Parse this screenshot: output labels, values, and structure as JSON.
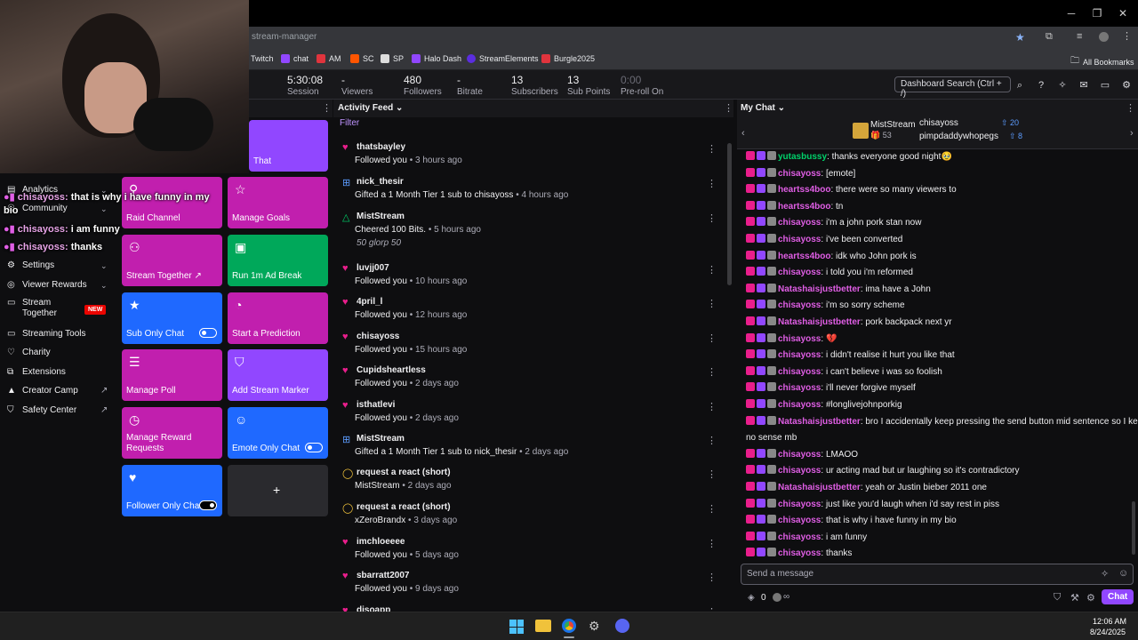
{
  "browser": {
    "url": "stream-manager",
    "bookmarks": [
      "Twitch",
      "chat",
      "AM",
      "SC",
      "SP",
      "Halo Dash",
      "StreamElements",
      "Burgle2025"
    ],
    "all_bookmarks": "All Bookmarks"
  },
  "stats": [
    {
      "value": "5:30:08",
      "label": "Session"
    },
    {
      "value": "-",
      "label": "Viewers"
    },
    {
      "value": "480",
      "label": "Followers"
    },
    {
      "value": "-",
      "label": "Bitrate"
    },
    {
      "value": "13",
      "label": "Subscribers"
    },
    {
      "value": "13",
      "label": "Sub Points"
    },
    {
      "value": "0:00",
      "label": "Pre-roll On"
    }
  ],
  "dashboard_search": "Dashboard Search (Ctrl + /)",
  "nav": [
    {
      "label": "Analytics"
    },
    {
      "label": "Community"
    },
    {
      "label": "Settings"
    },
    {
      "label": "Viewer Rewards"
    },
    {
      "label": "Stream Together",
      "badge": "NEW"
    },
    {
      "label": "Streaming Tools"
    },
    {
      "label": "Charity"
    },
    {
      "label": "Extensions"
    },
    {
      "label": "Creator Camp"
    },
    {
      "label": "Safety Center"
    }
  ],
  "overlay_chat": [
    {
      "user": "chisayoss:",
      "text": "that is why i have funny in my"
    },
    {
      "user": "",
      "text": "bio"
    },
    {
      "user": "chisayoss:",
      "text": "i am funny"
    },
    {
      "user": "chisayoss:",
      "text": "thanks"
    }
  ],
  "quick_actions": {
    "top_partial": "That",
    "tiles": [
      "Raid Channel",
      "Manage Goals",
      "Stream Together ↗",
      "Run 1m Ad Break",
      "Sub Only Chat",
      "Start a Prediction",
      "Manage Poll",
      "Add Stream Marker",
      "Manage Reward Requests",
      "Emote Only Chat",
      "Follower Only Chat",
      "+"
    ]
  },
  "activity": {
    "title": "Activity Feed",
    "filter": "Filter",
    "items": [
      {
        "name": "thatsbayley",
        "action": "Followed you",
        "time": "3 hours ago"
      },
      {
        "name": "nick_thesir",
        "action": "Gifted a 1 Month Tier 1 sub to chisayoss",
        "time": "4 hours ago"
      },
      {
        "name": "MistStream",
        "action": "Cheered 100 Bits.",
        "time": "5 hours ago",
        "extra": "50 glorp   50"
      },
      {
        "name": "luvjj007",
        "action": "Followed you",
        "time": "10 hours ago"
      },
      {
        "name": "4pril_l",
        "action": "Followed you",
        "time": "12 hours ago"
      },
      {
        "name": "chisayoss",
        "action": "Followed you",
        "time": "15 hours ago"
      },
      {
        "name": "Cupidsheartless",
        "action": "Followed you",
        "time": "2 days ago"
      },
      {
        "name": "isthatlevi",
        "action": "Followed you",
        "time": "2 days ago"
      },
      {
        "name": "MistStream",
        "action": "Gifted a 1 Month Tier 1 sub to nick_thesir",
        "time": "2 days ago"
      },
      {
        "name": "request a react (short)",
        "action": "MistStream",
        "time": "2 days ago"
      },
      {
        "name": "request a react (short)",
        "action": "xZeroBrandx",
        "time": "3 days ago"
      },
      {
        "name": "imchloeeee",
        "action": "Followed you",
        "time": "5 days ago"
      },
      {
        "name": "sbarratt2007",
        "action": "Followed you",
        "time": "9 days ago"
      },
      {
        "name": "disoapp",
        "action": "",
        "time": ""
      }
    ]
  },
  "chat": {
    "title": "My Chat",
    "leaderboard": [
      {
        "name": "MistStream",
        "count": "53"
      },
      {
        "name": "chisayoss",
        "count": "20"
      },
      {
        "name": "pimpdaddywhopegs",
        "count": "8"
      }
    ],
    "messages": [
      {
        "user": "yutasbussy",
        "color": "#00d26a",
        "text": "thanks everyone good night🥹"
      },
      {
        "user": "chisayoss",
        "color": "#e05ee5",
        "text": "[emote]"
      },
      {
        "user": "heartss4boo",
        "color": "#e05ee5",
        "text": "there were so many viewers to"
      },
      {
        "user": "heartss4boo",
        "color": "#e05ee5",
        "text": "tn"
      },
      {
        "user": "chisayoss",
        "color": "#e05ee5",
        "text": "i'm a john pork stan now"
      },
      {
        "user": "chisayoss",
        "color": "#e05ee5",
        "text": "i've been converted"
      },
      {
        "user": "heartss4boo",
        "color": "#e05ee5",
        "text": "idk who John pork is"
      },
      {
        "user": "chisayoss",
        "color": "#e05ee5",
        "text": "i told you i'm reformed"
      },
      {
        "user": "Natashaisjustbetter",
        "color": "#e05ee5",
        "text": "ima have a John"
      },
      {
        "user": "chisayoss",
        "color": "#e05ee5",
        "text": "i'm so sorry scheme"
      },
      {
        "user": "Natashaisjustbetter",
        "color": "#e05ee5",
        "text": "pork backpack next yr"
      },
      {
        "user": "chisayoss",
        "color": "#e05ee5",
        "text": "💔"
      },
      {
        "user": "chisayoss",
        "color": "#e05ee5",
        "text": "i didn't realise it hurt you like that"
      },
      {
        "user": "chisayoss",
        "color": "#e05ee5",
        "text": "i can't believe i was so foolish"
      },
      {
        "user": "chisayoss",
        "color": "#e05ee5",
        "text": "i'll never forgive myself"
      },
      {
        "user": "chisayoss",
        "color": "#e05ee5",
        "text": "#longlivejohnporkig"
      },
      {
        "user": "Natashaisjustbetter",
        "color": "#e05ee5",
        "text": "bro I accidentally keep pressing the send button mid sentence so I keep making"
      },
      {
        "user": "",
        "color": "#e05ee5",
        "text": "no sense mb"
      },
      {
        "user": "chisayoss",
        "color": "#e05ee5",
        "text": "LMAOO"
      },
      {
        "user": "chisayoss",
        "color": "#e05ee5",
        "text": "ur acting mad but ur laughing so it's contradictory"
      },
      {
        "user": "Natashaisjustbetter",
        "color": "#e05ee5",
        "text": "yeah or Justin bieber 2011 one"
      },
      {
        "user": "chisayoss",
        "color": "#e05ee5",
        "text": "just like you'd laugh when i'd say rest in piss"
      },
      {
        "user": "chisayoss",
        "color": "#e05ee5",
        "text": "that is why i have funny in my bio"
      },
      {
        "user": "chisayoss",
        "color": "#e05ee5",
        "text": "i am funny"
      },
      {
        "user": "chisayoss",
        "color": "#e05ee5",
        "text": "thanks"
      }
    ],
    "placeholder": "Send a message",
    "points": "0",
    "points_extra": "∞",
    "send_label": "Chat"
  },
  "clock": {
    "time": "12:06 AM",
    "date": "8/24/2025"
  },
  "colors": {
    "twitch_purple": "#9147ff",
    "tile_magenta": "#c11fae",
    "tile_blue": "#1f69ff",
    "tile_green": "#00a85a",
    "tile_purple": "#9147ff"
  }
}
